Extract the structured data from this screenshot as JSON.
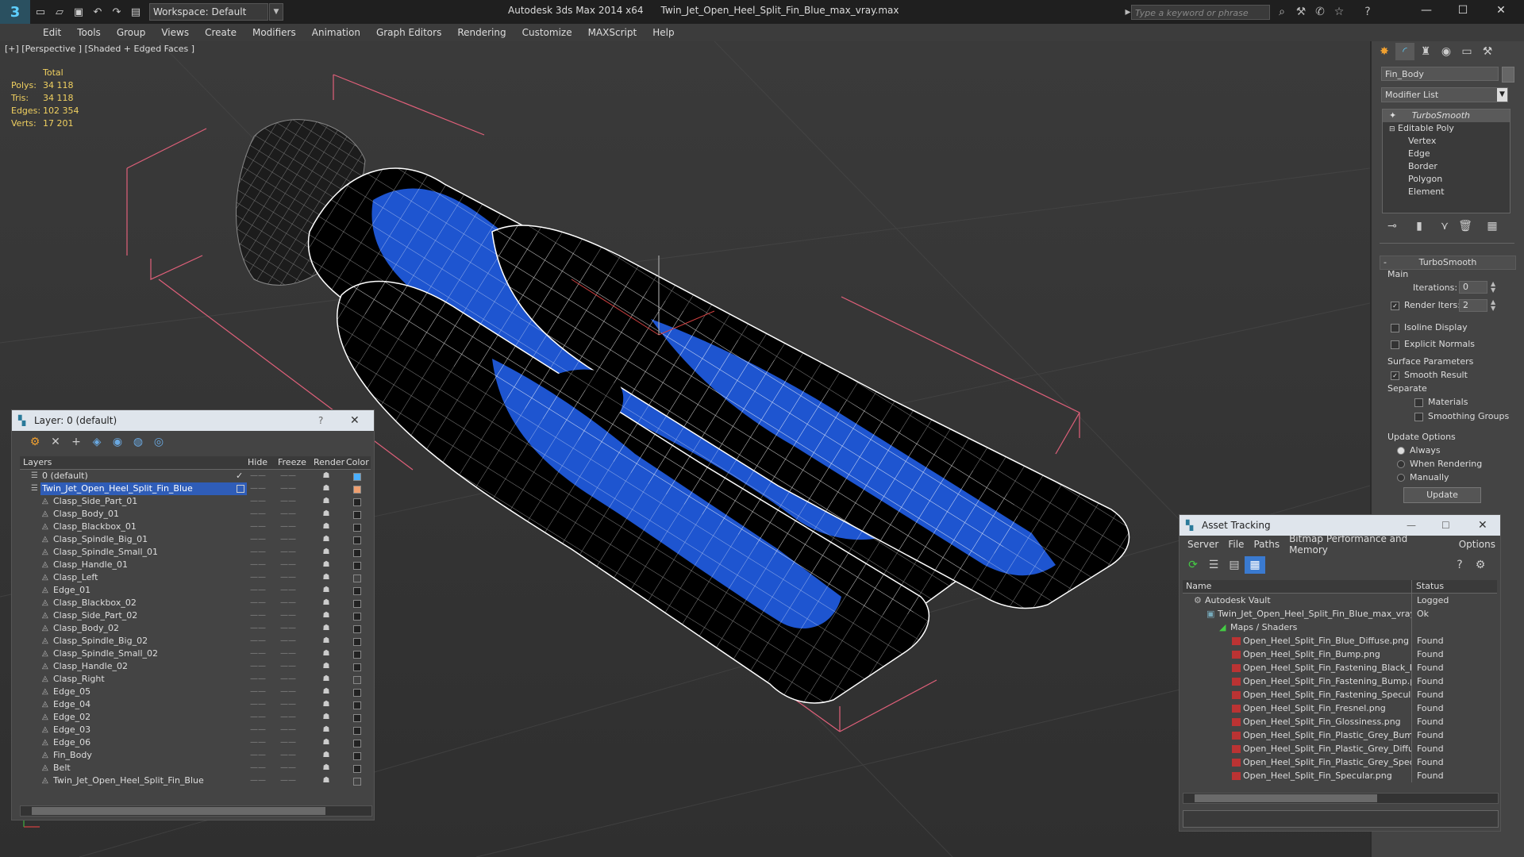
{
  "app": {
    "product": "Autodesk 3ds Max  2014 x64",
    "file": "Twin_Jet_Open_Heel_Split_Fin_Blue_max_vray.max",
    "workspace": "Workspace: Default",
    "search_placeholder": "Type a keyword or phrase"
  },
  "menu": [
    "Edit",
    "Tools",
    "Group",
    "Views",
    "Create",
    "Modifiers",
    "Animation",
    "Graph Editors",
    "Rendering",
    "Customize",
    "MAXScript",
    "Help"
  ],
  "viewport": {
    "label": "[+] [Perspective ] [Shaded + Edged Faces ]",
    "stats": {
      "total": "Total",
      "rows": [
        {
          "label": "Polys:",
          "value": "34 118"
        },
        {
          "label": "Tris:",
          "value": "34 118"
        },
        {
          "label": "Edges:",
          "value": "102 354"
        },
        {
          "label": "Verts:",
          "value": "17 201"
        }
      ]
    }
  },
  "command_panel": {
    "object_name": "Fin_Body",
    "modifier_list": "Modifier List",
    "stack": {
      "turbosmooth": "TurboSmooth",
      "editable_poly": "Editable Poly",
      "subobjects": [
        "Vertex",
        "Edge",
        "Border",
        "Polygon",
        "Element"
      ]
    },
    "turbosmooth": {
      "title": "TurboSmooth",
      "main": "Main",
      "iterations_label": "Iterations:",
      "iterations_value": "0",
      "render_iters_label": "Render Iters:",
      "render_iters_value": "2",
      "isoline": "Isoline Display",
      "explicit_normals": "Explicit Normals",
      "surface_params": "Surface Parameters",
      "smooth_result": "Smooth Result",
      "separate": "Separate",
      "materials": "Materials",
      "smoothing_groups": "Smoothing Groups",
      "update_options": "Update Options",
      "always": "Always",
      "when_rendering": "When Rendering",
      "manually": "Manually",
      "update_button": "Update"
    }
  },
  "layer_window": {
    "title": "Layer: 0 (default)",
    "help": "?",
    "columns": {
      "layers": "Layers",
      "hide": "Hide",
      "freeze": "Freeze",
      "render": "Render",
      "color": "Color"
    },
    "rows": [
      {
        "name": "0 (default)",
        "level": 1,
        "color": "#4ab0ff"
      },
      {
        "name": "Twin_Jet_Open_Heel_Split_Fin_Blue",
        "level": 1,
        "selected": true,
        "color": "#f0a070"
      },
      {
        "name": "Clasp_Side_Part_01",
        "level": 2,
        "color": "#222222"
      },
      {
        "name": "Clasp_Body_01",
        "level": 2,
        "color": "#222222"
      },
      {
        "name": "Clasp_Blackbox_01",
        "level": 2,
        "color": "#222222"
      },
      {
        "name": "Clasp_Spindle_Big_01",
        "level": 2,
        "color": "#222222"
      },
      {
        "name": "Clasp_Spindle_Small_01",
        "level": 2,
        "color": "#222222"
      },
      {
        "name": "Clasp_Handle_01",
        "level": 2,
        "color": "#222222"
      },
      {
        "name": "Clasp_Left",
        "level": 2,
        "color": "#444444"
      },
      {
        "name": "Edge_01",
        "level": 2,
        "color": "#222222"
      },
      {
        "name": "Clasp_Blackbox_02",
        "level": 2,
        "color": "#222222"
      },
      {
        "name": "Clasp_Side_Part_02",
        "level": 2,
        "color": "#222222"
      },
      {
        "name": "Clasp_Body_02",
        "level": 2,
        "color": "#222222"
      },
      {
        "name": "Clasp_Spindle_Big_02",
        "level": 2,
        "color": "#222222"
      },
      {
        "name": "Clasp_Spindle_Small_02",
        "level": 2,
        "color": "#222222"
      },
      {
        "name": "Clasp_Handle_02",
        "level": 2,
        "color": "#222222"
      },
      {
        "name": "Clasp_Right",
        "level": 2,
        "color": "#444444"
      },
      {
        "name": "Edge_05",
        "level": 2,
        "color": "#222222"
      },
      {
        "name": "Edge_04",
        "level": 2,
        "color": "#222222"
      },
      {
        "name": "Edge_02",
        "level": 2,
        "color": "#222222"
      },
      {
        "name": "Edge_03",
        "level": 2,
        "color": "#222222"
      },
      {
        "name": "Edge_06",
        "level": 2,
        "color": "#222222"
      },
      {
        "name": "Fin_Body",
        "level": 2,
        "color": "#222222"
      },
      {
        "name": "Belt",
        "level": 2,
        "color": "#222222"
      },
      {
        "name": "Twin_Jet_Open_Heel_Split_Fin_Blue",
        "level": 2,
        "color": "#444444"
      }
    ]
  },
  "asset_window": {
    "title": "Asset Tracking",
    "menu": [
      "Server",
      "File",
      "Paths",
      "Bitmap Performance and Memory",
      "Options"
    ],
    "columns": {
      "name": "Name",
      "status": "Status"
    },
    "rows": [
      {
        "name": "Autodesk Vault",
        "status": "Logged",
        "level": 0,
        "icon": "vault"
      },
      {
        "name": "Twin_Jet_Open_Heel_Split_Fin_Blue_max_vray.max",
        "status": "Ok",
        "level": 1,
        "icon": "max"
      },
      {
        "name": "Maps / Shaders",
        "status": "",
        "level": 2,
        "icon": "maps"
      },
      {
        "name": "Open_Heel_Split_Fin_Blue_Diffuse.png",
        "status": "Found",
        "level": 3,
        "icon": "png"
      },
      {
        "name": "Open_Heel_Split_Fin_Bump.png",
        "status": "Found",
        "level": 3,
        "icon": "png"
      },
      {
        "name": "Open_Heel_Split_Fin_Fastening_Black_Diffuse.png",
        "status": "Found",
        "level": 3,
        "icon": "png"
      },
      {
        "name": "Open_Heel_Split_Fin_Fastening_Bump.png",
        "status": "Found",
        "level": 3,
        "icon": "png"
      },
      {
        "name": "Open_Heel_Split_Fin_Fastening_Specular.png",
        "status": "Found",
        "level": 3,
        "icon": "png"
      },
      {
        "name": "Open_Heel_Split_Fin_Fresnel.png",
        "status": "Found",
        "level": 3,
        "icon": "png"
      },
      {
        "name": "Open_Heel_Split_Fin_Glossiness.png",
        "status": "Found",
        "level": 3,
        "icon": "png"
      },
      {
        "name": "Open_Heel_Split_Fin_Plastic_Grey_Bump.png",
        "status": "Found",
        "level": 3,
        "icon": "png"
      },
      {
        "name": "Open_Heel_Split_Fin_Plastic_Grey_Diffuse.png",
        "status": "Found",
        "level": 3,
        "icon": "png"
      },
      {
        "name": "Open_Heel_Split_Fin_Plastic_Grey_Specular.png",
        "status": "Found",
        "level": 3,
        "icon": "png"
      },
      {
        "name": "Open_Heel_Split_Fin_Specular.png",
        "status": "Found",
        "level": 3,
        "icon": "png"
      }
    ]
  },
  "colors": {
    "accent": "#2f5db8",
    "fin_blue": "#1e55d0",
    "stats_yellow": "#f0d060"
  }
}
